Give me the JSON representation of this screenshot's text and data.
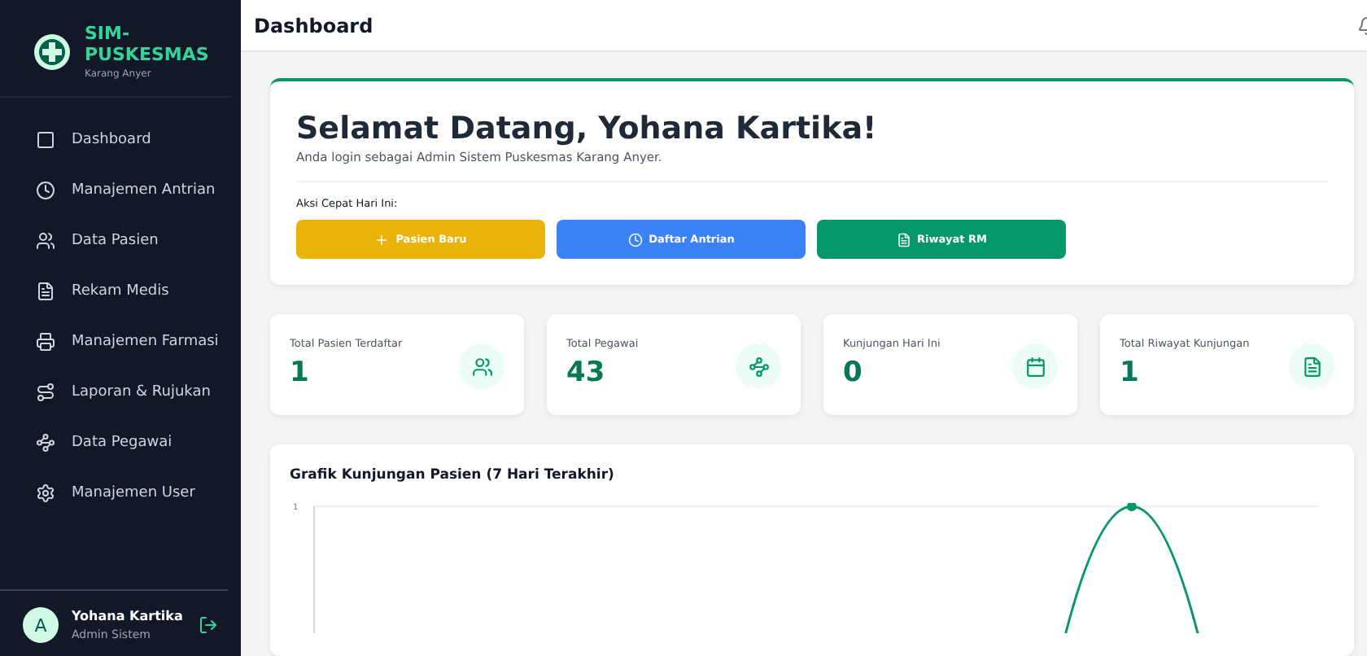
{
  "sidebar": {
    "brand": "SIM-PUSKESMAS",
    "subtitle": "Karang Anyer",
    "items": [
      {
        "label": "Dashboard",
        "selected": false
      },
      {
        "label": "Manajemen Antrian",
        "selected": false
      },
      {
        "label": "Data Pasien",
        "selected": false
      },
      {
        "label": "Rekam Medis",
        "selected": false
      },
      {
        "label": "Manajemen Farmasi",
        "selected": false
      },
      {
        "label": "Laporan & Rujukan",
        "selected": false
      },
      {
        "label": "Data Pegawai",
        "selected": false
      },
      {
        "label": "Manajemen User",
        "selected": false
      }
    ],
    "user": {
      "initial": "A",
      "name": "Yohana Kartika",
      "role": "Admin Sistem"
    }
  },
  "header": {
    "title": "Dashboard"
  },
  "welcome": {
    "title": "Selamat Datang, Yohana Kartika!",
    "subtitle": "Anda login sebagai Admin Sistem Puskesmas Karang Anyer.",
    "quick_label": "Aksi Cepat Hari Ini:",
    "buttons": [
      {
        "label": "Pasien Baru",
        "color": "#eab308"
      },
      {
        "label": "Daftar Antrian",
        "color": "#3b82f6"
      },
      {
        "label": "Riwayat RM",
        "color": "#059669"
      }
    ]
  },
  "stats": [
    {
      "label": "Total Pasien Terdaftar",
      "value": "1"
    },
    {
      "label": "Total Pegawai",
      "value": "43"
    },
    {
      "label": "Kunjungan Hari Ini",
      "value": "0"
    },
    {
      "label": "Total Riwayat Kunjungan",
      "value": "1"
    }
  ],
  "chart": {
    "title": "Grafik Kunjungan Pasien (7 Hari Terakhir)",
    "y_tick": "1"
  }
}
